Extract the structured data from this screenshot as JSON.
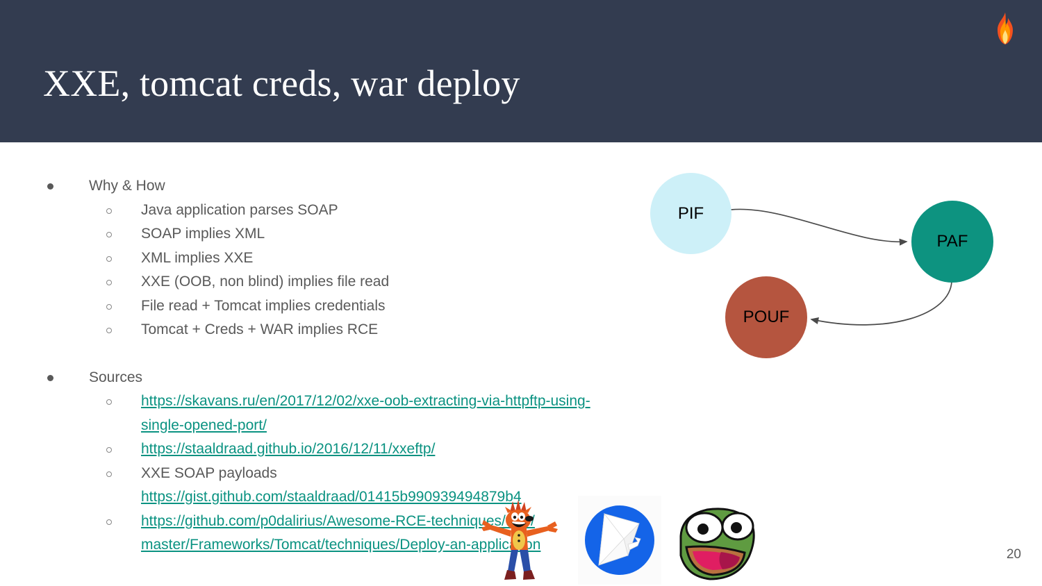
{
  "slide": {
    "title": "XXE, tomcat creds, war deploy",
    "page_number": "20",
    "header_color": "#333c50",
    "link_color": "#0a9281",
    "text_color": "#595959",
    "fire_emoji_name": "fire-emoji"
  },
  "outline": {
    "section_why": {
      "label": "Why & How",
      "items": [
        "Java application parses SOAP",
        "SOAP implies XML",
        "XML implies XXE",
        "XXE (OOB, non blind) implies file read",
        "File read + Tomcat implies credentials",
        "Tomcat + Creds + WAR implies RCE"
      ]
    },
    "section_sources": {
      "label": "Sources",
      "items": [
        {
          "prefix": "",
          "link": "https://skavans.ru/en/2017/12/02/xxe-oob-extracting-via-httpftp-using-single-opened-port/"
        },
        {
          "prefix": "",
          "link": "https://staaldraad.github.io/2016/12/11/xxeftp/"
        },
        {
          "prefix": "XXE SOAP payloads ",
          "link": "https://gist.github.com/staaldraad/01415b990939494879b4"
        },
        {
          "prefix": "",
          "link": "https://github.com/p0dalirius/Awesome-RCE-techniques/tree/master/Frameworks/Tomcat/techniques/Deploy-an-application"
        }
      ]
    }
  },
  "diagram": {
    "nodes": [
      {
        "id": "pif",
        "label": "PIF",
        "color": "#cdf0f8"
      },
      {
        "id": "paf",
        "label": "PAF",
        "color": "#0d9380"
      },
      {
        "id": "pouf",
        "label": "POUF",
        "color": "#b5553f"
      }
    ],
    "edges": [
      {
        "from": "PIF",
        "to": "PAF"
      },
      {
        "from": "PAF",
        "to": "POUF"
      }
    ],
    "edge_color": "#4a4a4a"
  },
  "images": [
    {
      "name": "crash-bandicoot-image"
    },
    {
      "name": "paper-crane-image"
    },
    {
      "name": "pepe-frog-image"
    }
  ]
}
